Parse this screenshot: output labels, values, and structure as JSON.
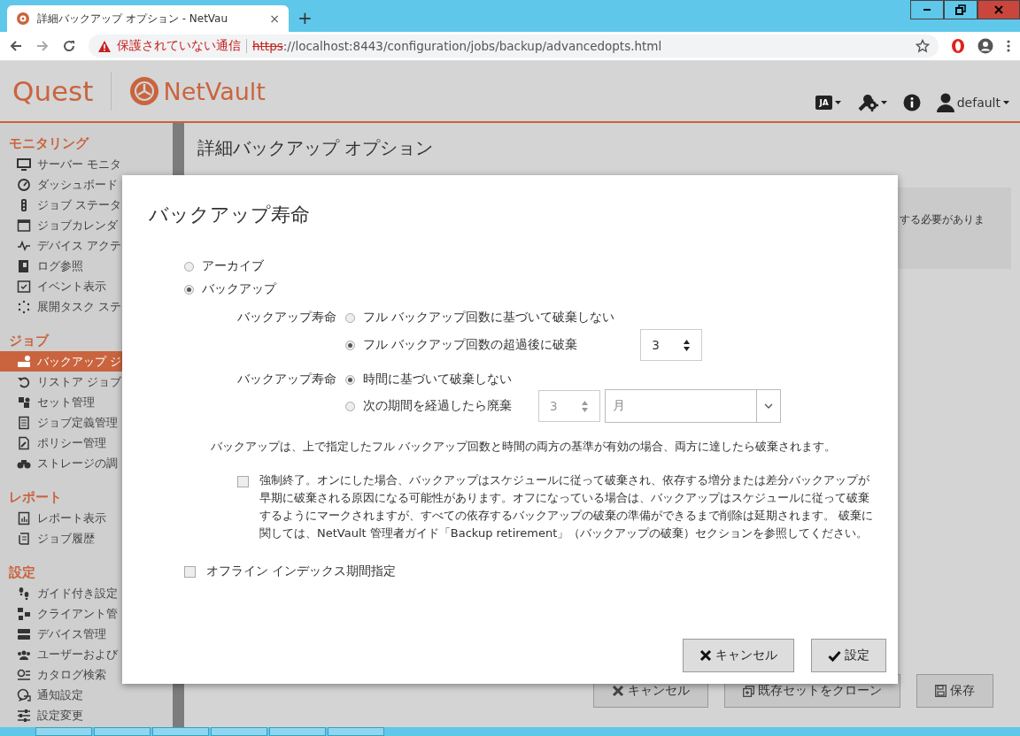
{
  "browser": {
    "tab_title": "詳細バックアップ オプション - NetVau",
    "tab_close": "×",
    "new_tab": "+",
    "security_label": "保護されていない通信",
    "url_scheme": "https",
    "url_rest": "://localhost:8443/configuration/jobs/backup/advancedopts.html"
  },
  "header": {
    "brand": "Quest",
    "product": "NetVault",
    "language": "JA",
    "user": "default"
  },
  "sidebar": {
    "sections": [
      {
        "title": "モニタリング",
        "items": [
          {
            "label": "サーバー モニタ",
            "selected": false
          },
          {
            "label": "ダッシュボード",
            "selected": false
          },
          {
            "label": "ジョブ ステータ",
            "selected": false
          },
          {
            "label": "ジョブカレンダ",
            "selected": false
          },
          {
            "label": "デバイス アクテ",
            "selected": false
          },
          {
            "label": "ログ参照",
            "selected": false
          },
          {
            "label": "イベント表示",
            "selected": false
          },
          {
            "label": "展開タスク ステ",
            "selected": false
          }
        ]
      },
      {
        "title": "ジョブ",
        "items": [
          {
            "label": "バックアップ ジ",
            "selected": true
          },
          {
            "label": "リストア ジョブ",
            "selected": false
          },
          {
            "label": "セット管理",
            "selected": false
          },
          {
            "label": "ジョブ定義管理",
            "selected": false
          },
          {
            "label": "ポリシー管理",
            "selected": false
          },
          {
            "label": "ストレージの調",
            "selected": false
          }
        ]
      },
      {
        "title": "レポート",
        "items": [
          {
            "label": "レポート表示",
            "selected": false
          },
          {
            "label": "ジョブ履歴",
            "selected": false
          }
        ]
      },
      {
        "title": "設定",
        "items": [
          {
            "label": "ガイド付き設定",
            "selected": false
          },
          {
            "label": "クライアント管",
            "selected": false
          },
          {
            "label": "デバイス管理",
            "selected": false
          },
          {
            "label": "ユーザーおよび",
            "selected": false
          },
          {
            "label": "カタログ検索",
            "selected": false
          },
          {
            "label": "通知設定",
            "selected": false
          },
          {
            "label": "設定変更",
            "selected": false
          }
        ]
      }
    ]
  },
  "page": {
    "title": "詳細バックアップ オプション",
    "notice": "する必要がありま",
    "buttons": [
      {
        "label": "キャンセル",
        "kind": "cancel"
      },
      {
        "label": "既存セットをクローン",
        "kind": "clone"
      },
      {
        "label": "保存",
        "kind": "save"
      }
    ]
  },
  "dialog": {
    "title": "バックアップ寿命",
    "types": [
      {
        "label": "アーカイブ",
        "selected": false
      },
      {
        "label": "バックアップ",
        "selected": true
      }
    ],
    "groups": [
      {
        "label": "バックアップ寿命",
        "options": [
          {
            "label": "フル バックアップ回数に基づいて破棄しない",
            "selected": false
          },
          {
            "label": "フル バックアップ回数の超過後に破棄",
            "selected": true
          }
        ],
        "spinner": {
          "value": "3",
          "disabled": false
        }
      },
      {
        "label": "バックアップ寿命",
        "options": [
          {
            "label": "時間に基づいて破棄しない",
            "selected": true
          },
          {
            "label": "次の期間を経過したら廃棄",
            "selected": false
          }
        ],
        "spinner": {
          "value": "3",
          "disabled": true
        },
        "select": {
          "value": "月",
          "disabled": true
        }
      }
    ],
    "note": "バックアップは、上で指定したフル バックアップ回数と時間の両方の基準が有効の場合、両方に達したら破棄されます。",
    "force": {
      "checked": false,
      "text": "強制終了。オンにした場合、バックアップはスケジュールに従って破棄され、依存する増分または差分バックアップが早期に破棄される原因になる可能性があります。オフになっている場合は、バックアップはスケジュールに従って破棄するようにマークされますが、すべての依存するバックアップの破棄の準備ができるまで削除は延期されます。 破棄に関しては、NetVault 管理者ガイド「Backup retirement」（バックアップの破棄）セクションを参照してください。"
    },
    "offline": {
      "checked": false,
      "label": "オフライン インデックス期間指定"
    },
    "buttons": [
      {
        "label": "キャンセル",
        "kind": "cancel"
      },
      {
        "label": "設定",
        "kind": "ok"
      }
    ]
  }
}
